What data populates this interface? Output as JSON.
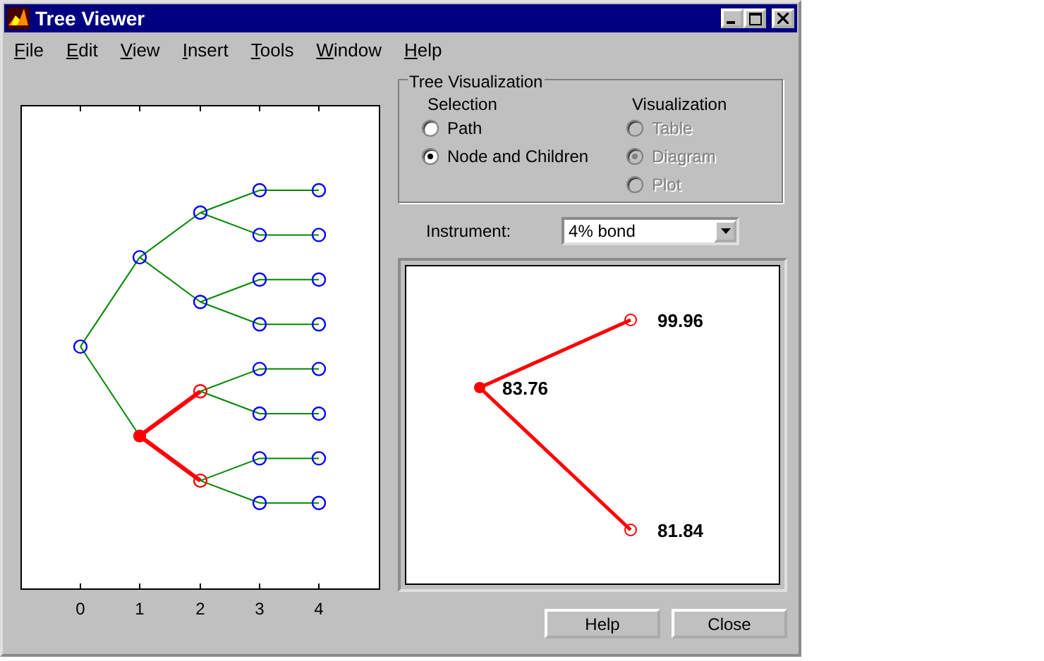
{
  "window": {
    "title": "Tree Viewer"
  },
  "menu": [
    "File",
    "Edit",
    "View",
    "Insert",
    "Tools",
    "Window",
    "Help"
  ],
  "tree_plot": {
    "xticks": [
      "0",
      "1",
      "2",
      "3",
      "4"
    ],
    "root": {
      "selected": false,
      "children": [
        {
          "selected": false,
          "children": [
            {
              "selected": false,
              "children": [
                {
                  "selected": false,
                  "children": [
                    {
                      "selected": false
                    }
                  ]
                },
                {
                  "selected": false,
                  "children": [
                    {
                      "selected": false
                    }
                  ]
                }
              ]
            },
            {
              "selected": false,
              "children": [
                {
                  "selected": false,
                  "children": [
                    {
                      "selected": false
                    }
                  ]
                },
                {
                  "selected": false,
                  "children": [
                    {
                      "selected": false
                    }
                  ]
                }
              ]
            }
          ]
        },
        {
          "selected": true,
          "children": [
            {
              "selected": false,
              "children": [
                {
                  "selected": false,
                  "children": [
                    {
                      "selected": false
                    }
                  ]
                },
                {
                  "selected": false,
                  "children": [
                    {
                      "selected": false
                    }
                  ]
                }
              ]
            },
            {
              "selected": false,
              "children": [
                {
                  "selected": false,
                  "children": [
                    {
                      "selected": false
                    }
                  ]
                },
                {
                  "selected": false,
                  "children": [
                    {
                      "selected": false
                    }
                  ]
                }
              ]
            }
          ]
        }
      ]
    }
  },
  "tree_visualization": {
    "title": "Tree Visualization",
    "selection": {
      "heading": "Selection",
      "options": [
        {
          "label": "Path",
          "selected": false,
          "disabled": false
        },
        {
          "label": "Node and Children",
          "selected": true,
          "disabled": false
        }
      ]
    },
    "visualization": {
      "heading": "Visualization",
      "options": [
        {
          "label": "Table",
          "selected": false,
          "disabled": true
        },
        {
          "label": "Diagram",
          "selected": true,
          "disabled": true
        },
        {
          "label": "Plot",
          "selected": false,
          "disabled": true
        }
      ]
    }
  },
  "instrument": {
    "label": "Instrument:",
    "value": "4% bond"
  },
  "node_detail": {
    "parent": {
      "value": "83.76"
    },
    "children": [
      {
        "value": "99.96"
      },
      {
        "value": "81.84"
      }
    ]
  },
  "buttons": [
    "Help",
    "Close"
  ]
}
